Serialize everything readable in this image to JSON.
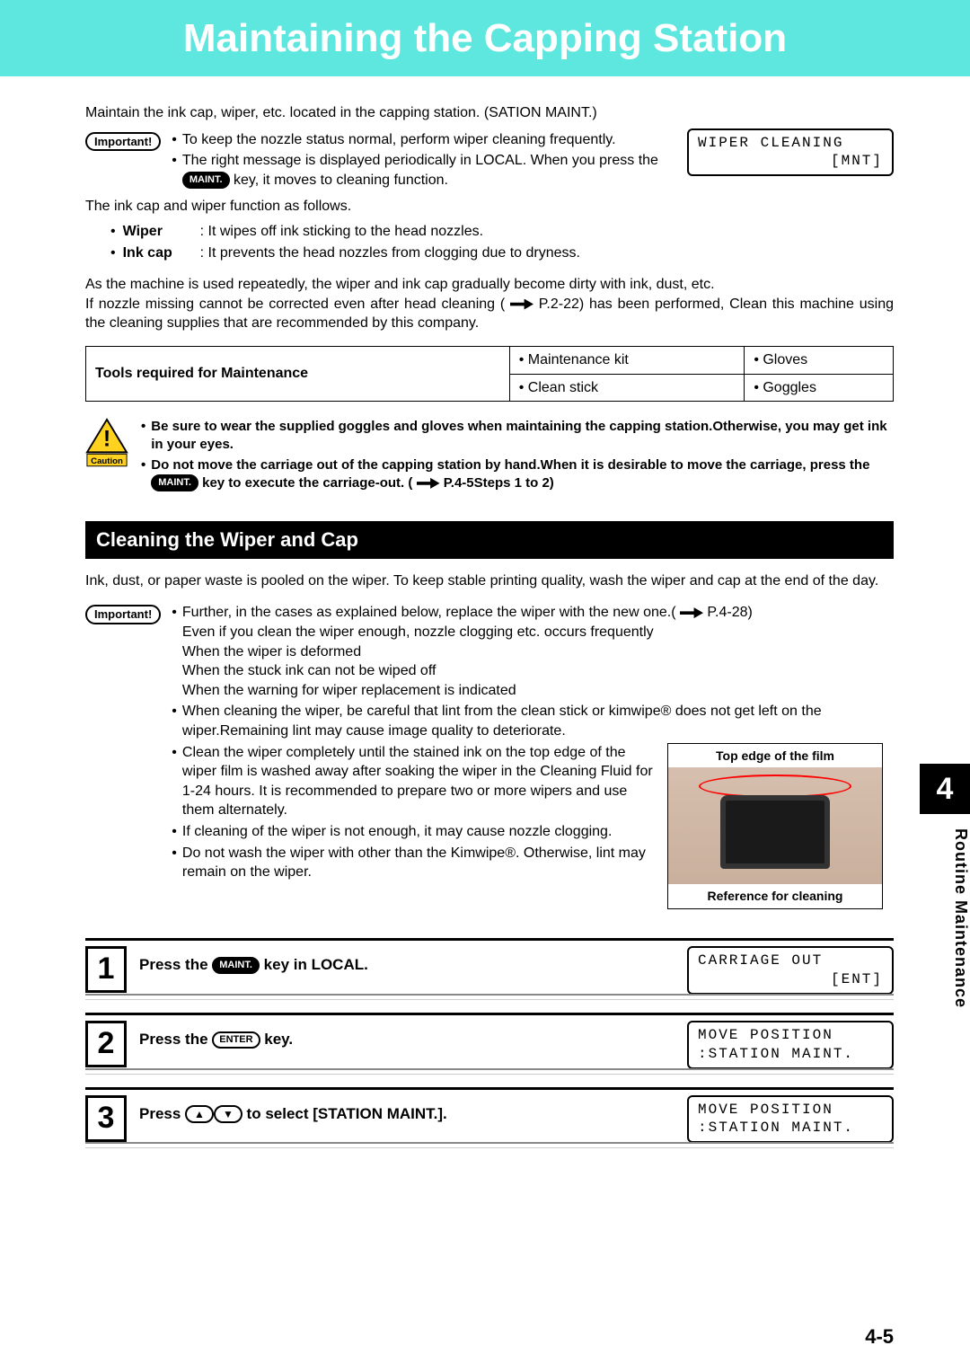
{
  "title": "Maintaining the Capping Station",
  "intro": "Maintain the ink cap, wiper, etc. located in the capping station. (SATION MAINT.)",
  "important_label": "Important!",
  "imp1": {
    "b1": "To keep the nozzle status normal, perform wiper cleaning frequently.",
    "b2a": "The right message is displayed periodically in LOCAL. When you press the ",
    "b2b": " key, it moves to cleaning function."
  },
  "key_maint": "MAINT.",
  "key_enter": "ENTER",
  "lcd_top": {
    "l1": "WIPER CLEANING",
    "l2": "[MNT]"
  },
  "func_intro": "The ink cap and wiper function as follows.",
  "func": {
    "wiper_lbl": "Wiper",
    "wiper_txt": ":  It wipes off ink sticking to the head nozzles.",
    "cap_lbl": "Ink cap",
    "cap_txt": ":  It prevents the head nozzles from clogging due to dryness."
  },
  "para2a": "As the machine is used repeatedly, the wiper and ink cap gradually become dirty with ink, dust, etc.",
  "para2b": "If nozzle missing cannot be corrected even after head cleaning ( ",
  "para2c": " P.2-22) has been performed, Clean this machine using the cleaning supplies that are recommended by this company.",
  "tools": {
    "head": "Tools required for Maintenance",
    "r1c1": "Maintenance kit",
    "r1c2": "Gloves",
    "r2c1": "Clean stick",
    "r2c2": "Goggles"
  },
  "caution_label": "Caution",
  "caution": {
    "b1": "Be sure to wear the supplied goggles and gloves when maintaining the capping station.Otherwise, you may get ink in your eyes.",
    "b2a": "Do not move the carriage out of the capping station by hand.When it is desirable to move the carriage, press the ",
    "b2b": " key to execute the carriage-out. ( ",
    "b2c": " P.4-5Steps 1 to 2)"
  },
  "section2": "Cleaning the Wiper and Cap",
  "sec2_p": "Ink, dust, or paper waste is pooled on the wiper. To keep stable printing quality, wash the wiper and cap at the end of the day.",
  "imp2": {
    "b1a": "Further, in the cases as explained below, replace the wiper with the new one.( ",
    "b1b": " P.4-28)",
    "b1c": "Even if you clean the wiper enough, nozzle clogging etc. occurs frequently",
    "b1d": "When the wiper is deformed",
    "b1e": "When the stuck ink can not be wiped off",
    "b1f": "When the warning for wiper replacement is indicated",
    "b2": "When cleaning the wiper, be careful that lint from the clean stick or kimwipe® does not get left on the wiper.Remaining lint may cause image quality to deteriorate.",
    "b3": "Clean the wiper completely until the stained ink on the top edge of the wiper film is washed away after soaking the wiper in the Cleaning Fluid for 1-24 hours. It is recommended to prepare two or more wipers and use them alternately.",
    "b4": "If cleaning of the wiper is not enough, it may cause nozzle clogging.",
    "b5": "Do not wash the wiper with other than the Kimwipe®. Otherwise, lint may remain on the wiper."
  },
  "photo": {
    "top": "Top edge of the film",
    "bot": "Reference for cleaning"
  },
  "steps": {
    "s1a": "Press the ",
    "s1b": " key in LOCAL.",
    "s2a": "Press the ",
    "s2b": " key.",
    "s3a": "Press ",
    "s3b": " to select [STATION MAINT.]."
  },
  "lcd1": {
    "l1": "CARRIAGE OUT",
    "l2": "[ENT]"
  },
  "lcd2": {
    "l1": "MOVE POSITION",
    "l2": ":STATION MAINT."
  },
  "lcd3": {
    "l1": "MOVE POSITION",
    "l2": ":STATION MAINT."
  },
  "chapter_num": "4",
  "chapter_name": "Routine Maintenance",
  "page_num": "4-5"
}
